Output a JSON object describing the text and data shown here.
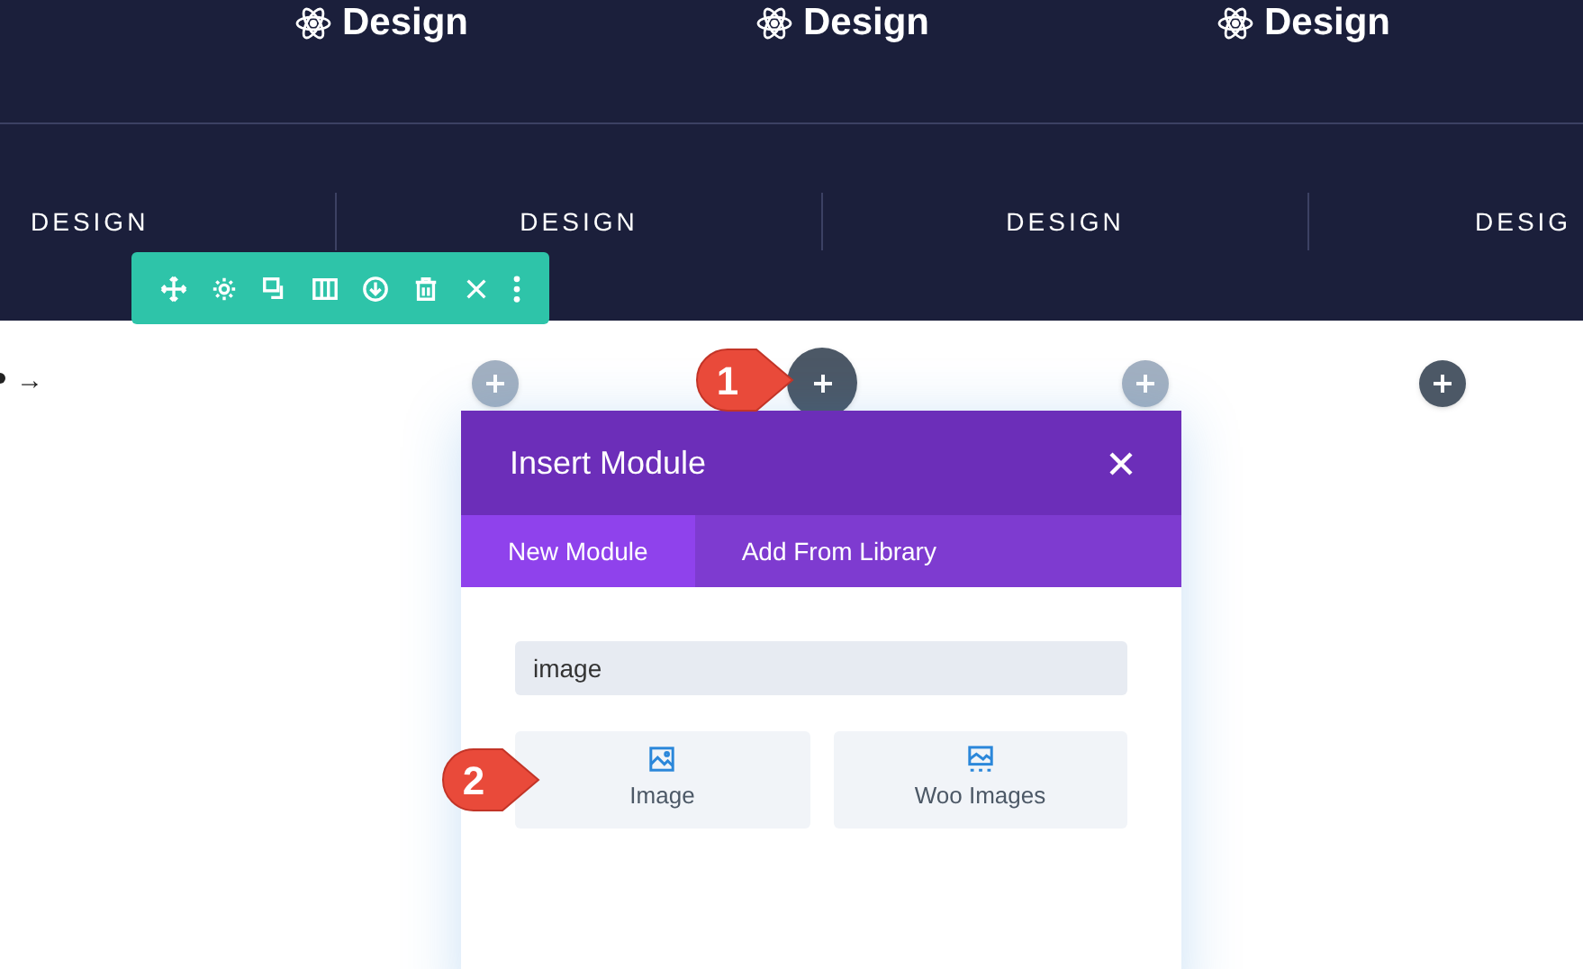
{
  "header": {
    "titles": [
      "Design",
      "Design",
      "Design"
    ],
    "nav": [
      "DESIGN",
      "DESIGN",
      "DESIGN",
      "DESIG"
    ]
  },
  "row_toolbar": {
    "tools": [
      {
        "kind": "move"
      },
      {
        "kind": "settings"
      },
      {
        "kind": "duplicate"
      },
      {
        "kind": "columns"
      },
      {
        "kind": "save"
      },
      {
        "kind": "delete"
      },
      {
        "kind": "close"
      },
      {
        "kind": "more"
      }
    ]
  },
  "page_fragment": {
    "text": "→"
  },
  "add_buttons": [
    {
      "kind": "column",
      "selected": false
    },
    {
      "kind": "column",
      "selected": true
    },
    {
      "kind": "column",
      "selected": false
    },
    {
      "kind": "row",
      "selected": true
    }
  ],
  "modal": {
    "title": "Insert Module",
    "tabs": [
      {
        "label": "New Module",
        "selected": true
      },
      {
        "label": "Add From Library",
        "selected": false
      }
    ],
    "search": {
      "value": "image"
    },
    "modules": [
      {
        "label": "Image",
        "kind": "image"
      },
      {
        "label": "Woo Images",
        "kind": "gallery"
      }
    ]
  },
  "callouts": [
    "1",
    "2"
  ]
}
